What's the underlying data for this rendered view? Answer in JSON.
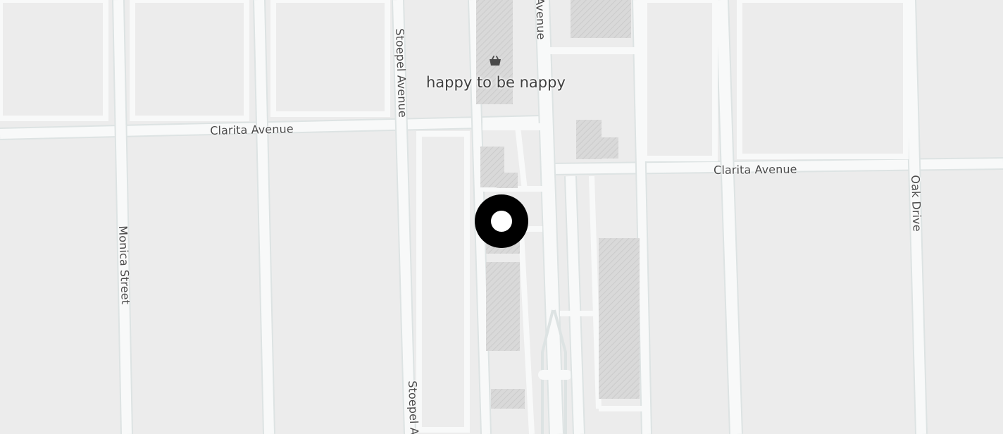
{
  "map": {
    "colors": {
      "background": "#ececec",
      "road": "#f8f9f9",
      "road_casing": "#dde3e3",
      "building": "#d6d6d6",
      "marker_ring": "#000000",
      "marker_center": "#ffffff",
      "poi_icon": "#4a4a4a"
    },
    "streets": {
      "clarita_west": "Clarita Avenue",
      "clarita_east": "Clarita Avenue",
      "stoepel_north": "Stoepel Avenue",
      "stoepel_south": "Stoepel A",
      "monica": "Monica Street",
      "oak": "Oak Drive",
      "avenue_top": "Avenue"
    },
    "poi": {
      "name": "happy to be nappy",
      "icon": "shopping-basket-icon"
    },
    "marker": {
      "icon": "location-marker-icon"
    }
  }
}
